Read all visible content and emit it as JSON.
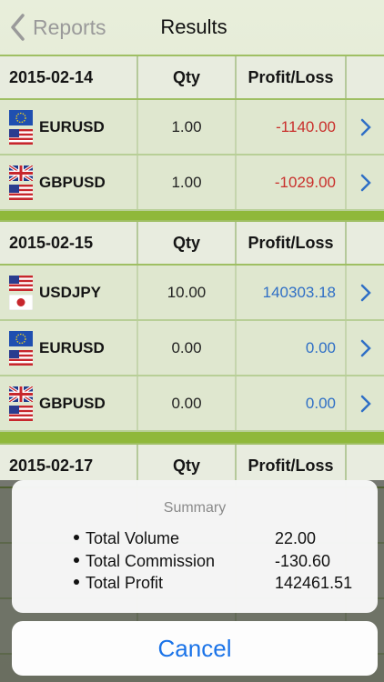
{
  "nav": {
    "back_label": "Reports",
    "title": "Results"
  },
  "columns": {
    "qty": "Qty",
    "pl": "Profit/Loss"
  },
  "sections": [
    {
      "date": "2015-02-14",
      "rows": [
        {
          "symbol": "EURUSD",
          "qty": "1.00",
          "pl": "-1140.00",
          "sign": "neg",
          "flags": [
            "eu",
            "us"
          ]
        },
        {
          "symbol": "GBPUSD",
          "qty": "1.00",
          "pl": "-1029.00",
          "sign": "neg",
          "flags": [
            "gb",
            "us"
          ]
        }
      ]
    },
    {
      "date": "2015-02-15",
      "rows": [
        {
          "symbol": "USDJPY",
          "qty": "10.00",
          "pl": "140303.18",
          "sign": "pos",
          "flags": [
            "us",
            "jp"
          ]
        },
        {
          "symbol": "EURUSD",
          "qty": "0.00",
          "pl": "0.00",
          "sign": "pos",
          "flags": [
            "eu",
            "us"
          ]
        },
        {
          "symbol": "GBPUSD",
          "qty": "0.00",
          "pl": "0.00",
          "sign": "pos",
          "flags": [
            "gb",
            "us"
          ]
        }
      ]
    },
    {
      "date": "2015-02-17",
      "rows": []
    }
  ],
  "summary": {
    "title": "Summary",
    "items": [
      {
        "label": "Total Volume",
        "value": "22.00"
      },
      {
        "label": "Total Commission",
        "value": "-130.60"
      },
      {
        "label": "Total Profit",
        "value": "142461.51"
      }
    ],
    "cancel_label": "Cancel"
  },
  "colors": {
    "accent": "#1a73e8",
    "negative": "#c9302c",
    "positive": "#2f6fc6",
    "separator": "#8fb83a"
  }
}
